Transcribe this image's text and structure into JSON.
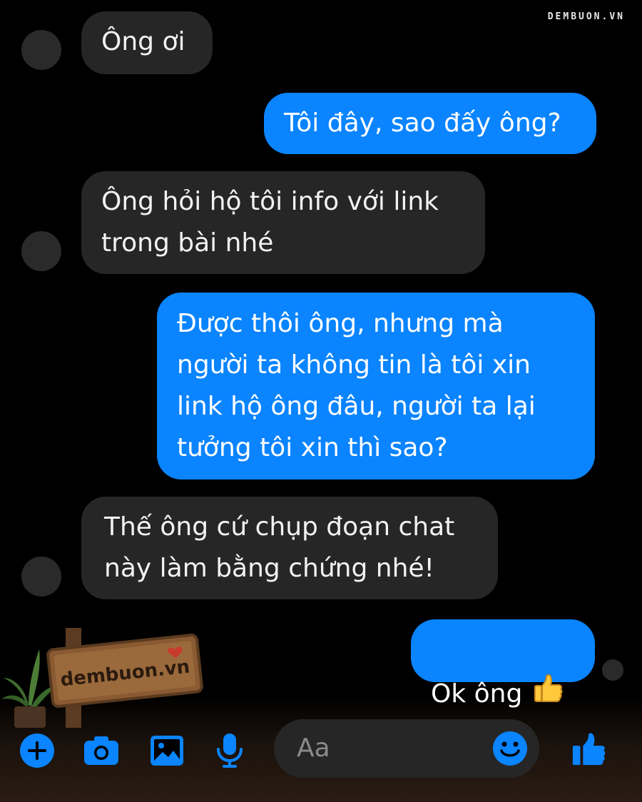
{
  "watermark": "DEMBUON.VN",
  "messages": [
    {
      "side": "in",
      "text": "Ông ơi"
    },
    {
      "side": "out",
      "text": "Tôi đây, sao đấy ông?"
    },
    {
      "side": "in",
      "text": "Ông hỏi hộ tôi info với link\ntrong bài nhé"
    },
    {
      "side": "out",
      "text": "Được thôi ông, nhưng mà\nngười ta không tin là tôi xin\nlink hộ ông đâu, người ta lại\ntưởng tôi xin thì sao?"
    },
    {
      "side": "in",
      "text": "Thế ông cứ chụp đoạn chat\nnày làm bằng chứng nhé!"
    },
    {
      "side": "out",
      "text": "Ok ông",
      "emoji": "thumbs-up"
    }
  ],
  "sign": {
    "text": "dembuon.vn"
  },
  "composer": {
    "placeholder": "Aa",
    "icons": [
      "plus-icon",
      "camera-icon",
      "image-icon",
      "microphone-icon",
      "emoji-icon",
      "like-icon"
    ]
  },
  "colors": {
    "accent": "#0a84ff",
    "incoming_bubble": "#262626",
    "background": "#000000"
  }
}
